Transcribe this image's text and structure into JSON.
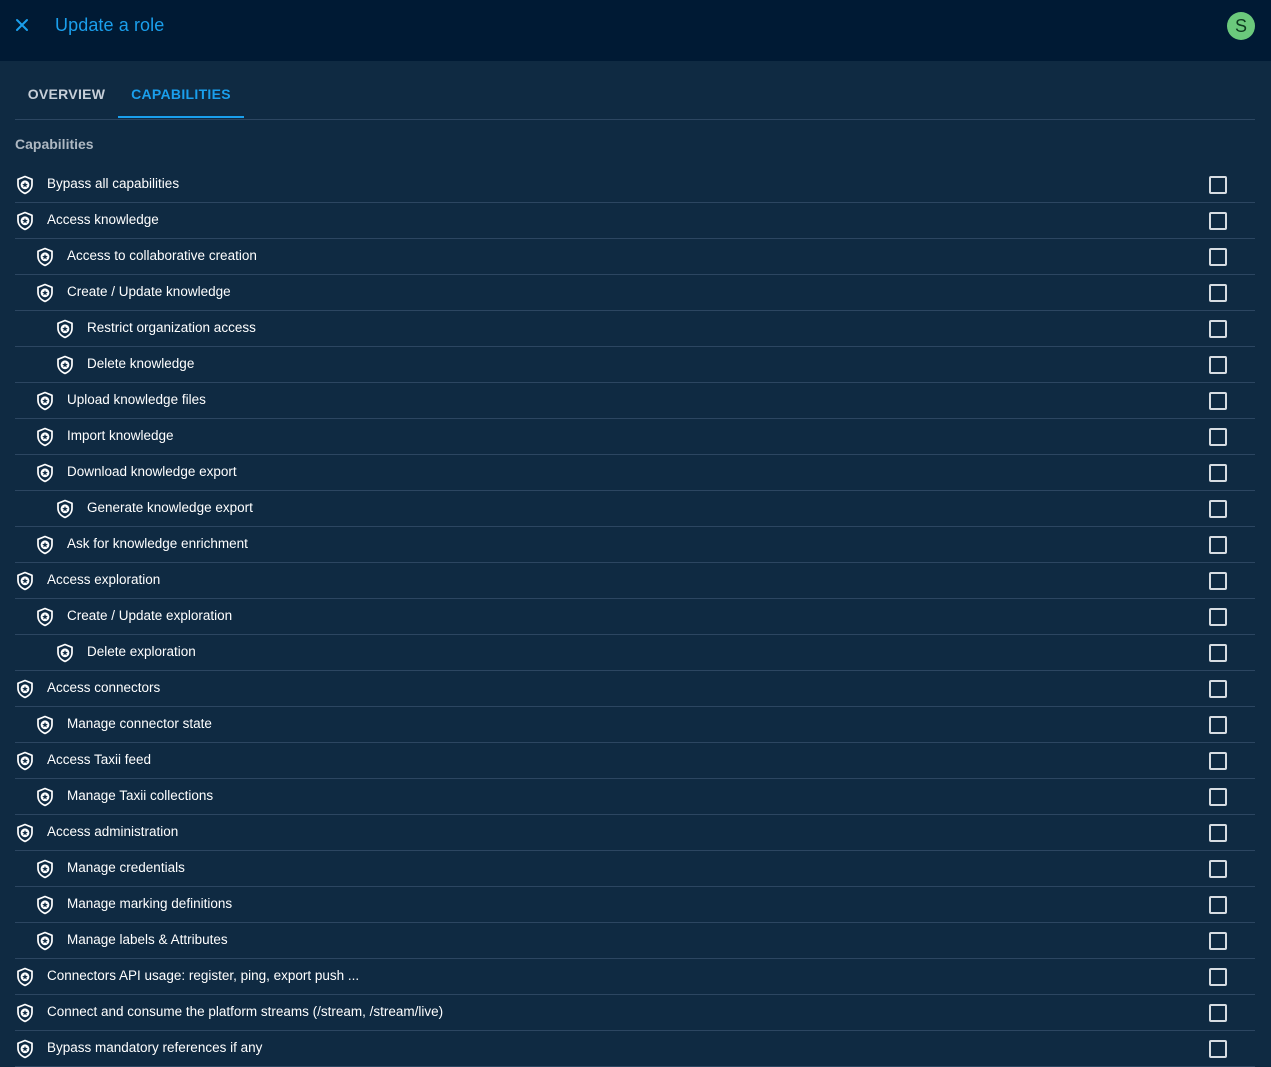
{
  "header": {
    "title": "Update a role",
    "close_icon": "close-icon",
    "avatar_initial": "S",
    "avatar_color": "#6bc97c"
  },
  "tabs": [
    {
      "label": "OVERVIEW",
      "active": false
    },
    {
      "label": "CAPABILITIES",
      "active": true
    }
  ],
  "colors": {
    "accent": "#1a9fec",
    "background": "#0f2a42",
    "topbar": "#001a34"
  },
  "capabilities": {
    "section_title": "Capabilities",
    "items": [
      {
        "label": "Bypass all capabilities",
        "level": 0,
        "checked": false
      },
      {
        "label": "Access knowledge",
        "level": 0,
        "checked": false
      },
      {
        "label": "Access to collaborative creation",
        "level": 1,
        "checked": false
      },
      {
        "label": "Create / Update knowledge",
        "level": 1,
        "checked": false
      },
      {
        "label": "Restrict organization access",
        "level": 2,
        "checked": false
      },
      {
        "label": "Delete knowledge",
        "level": 2,
        "checked": false
      },
      {
        "label": "Upload knowledge files",
        "level": 1,
        "checked": false
      },
      {
        "label": "Import knowledge",
        "level": 1,
        "checked": false
      },
      {
        "label": "Download knowledge export",
        "level": 1,
        "checked": false
      },
      {
        "label": "Generate knowledge export",
        "level": 2,
        "checked": false
      },
      {
        "label": "Ask for knowledge enrichment",
        "level": 1,
        "checked": false
      },
      {
        "label": "Access exploration",
        "level": 0,
        "checked": false
      },
      {
        "label": "Create / Update exploration",
        "level": 1,
        "checked": false
      },
      {
        "label": "Delete exploration",
        "level": 2,
        "checked": false
      },
      {
        "label": "Access connectors",
        "level": 0,
        "checked": false
      },
      {
        "label": "Manage connector state",
        "level": 1,
        "checked": false
      },
      {
        "label": "Access Taxii feed",
        "level": 0,
        "checked": false
      },
      {
        "label": "Manage Taxii collections",
        "level": 1,
        "checked": false
      },
      {
        "label": "Access administration",
        "level": 0,
        "checked": false
      },
      {
        "label": "Manage credentials",
        "level": 1,
        "checked": false
      },
      {
        "label": "Manage marking definitions",
        "level": 1,
        "checked": false
      },
      {
        "label": "Manage labels & Attributes",
        "level": 1,
        "checked": false
      },
      {
        "label": "Connectors API usage: register, ping, export push ...",
        "level": 0,
        "checked": false
      },
      {
        "label": "Connect and consume the platform streams (/stream, /stream/live)",
        "level": 0,
        "checked": false
      },
      {
        "label": "Bypass mandatory references if any",
        "level": 0,
        "checked": false
      }
    ],
    "item_icon": "shield-star-icon"
  }
}
